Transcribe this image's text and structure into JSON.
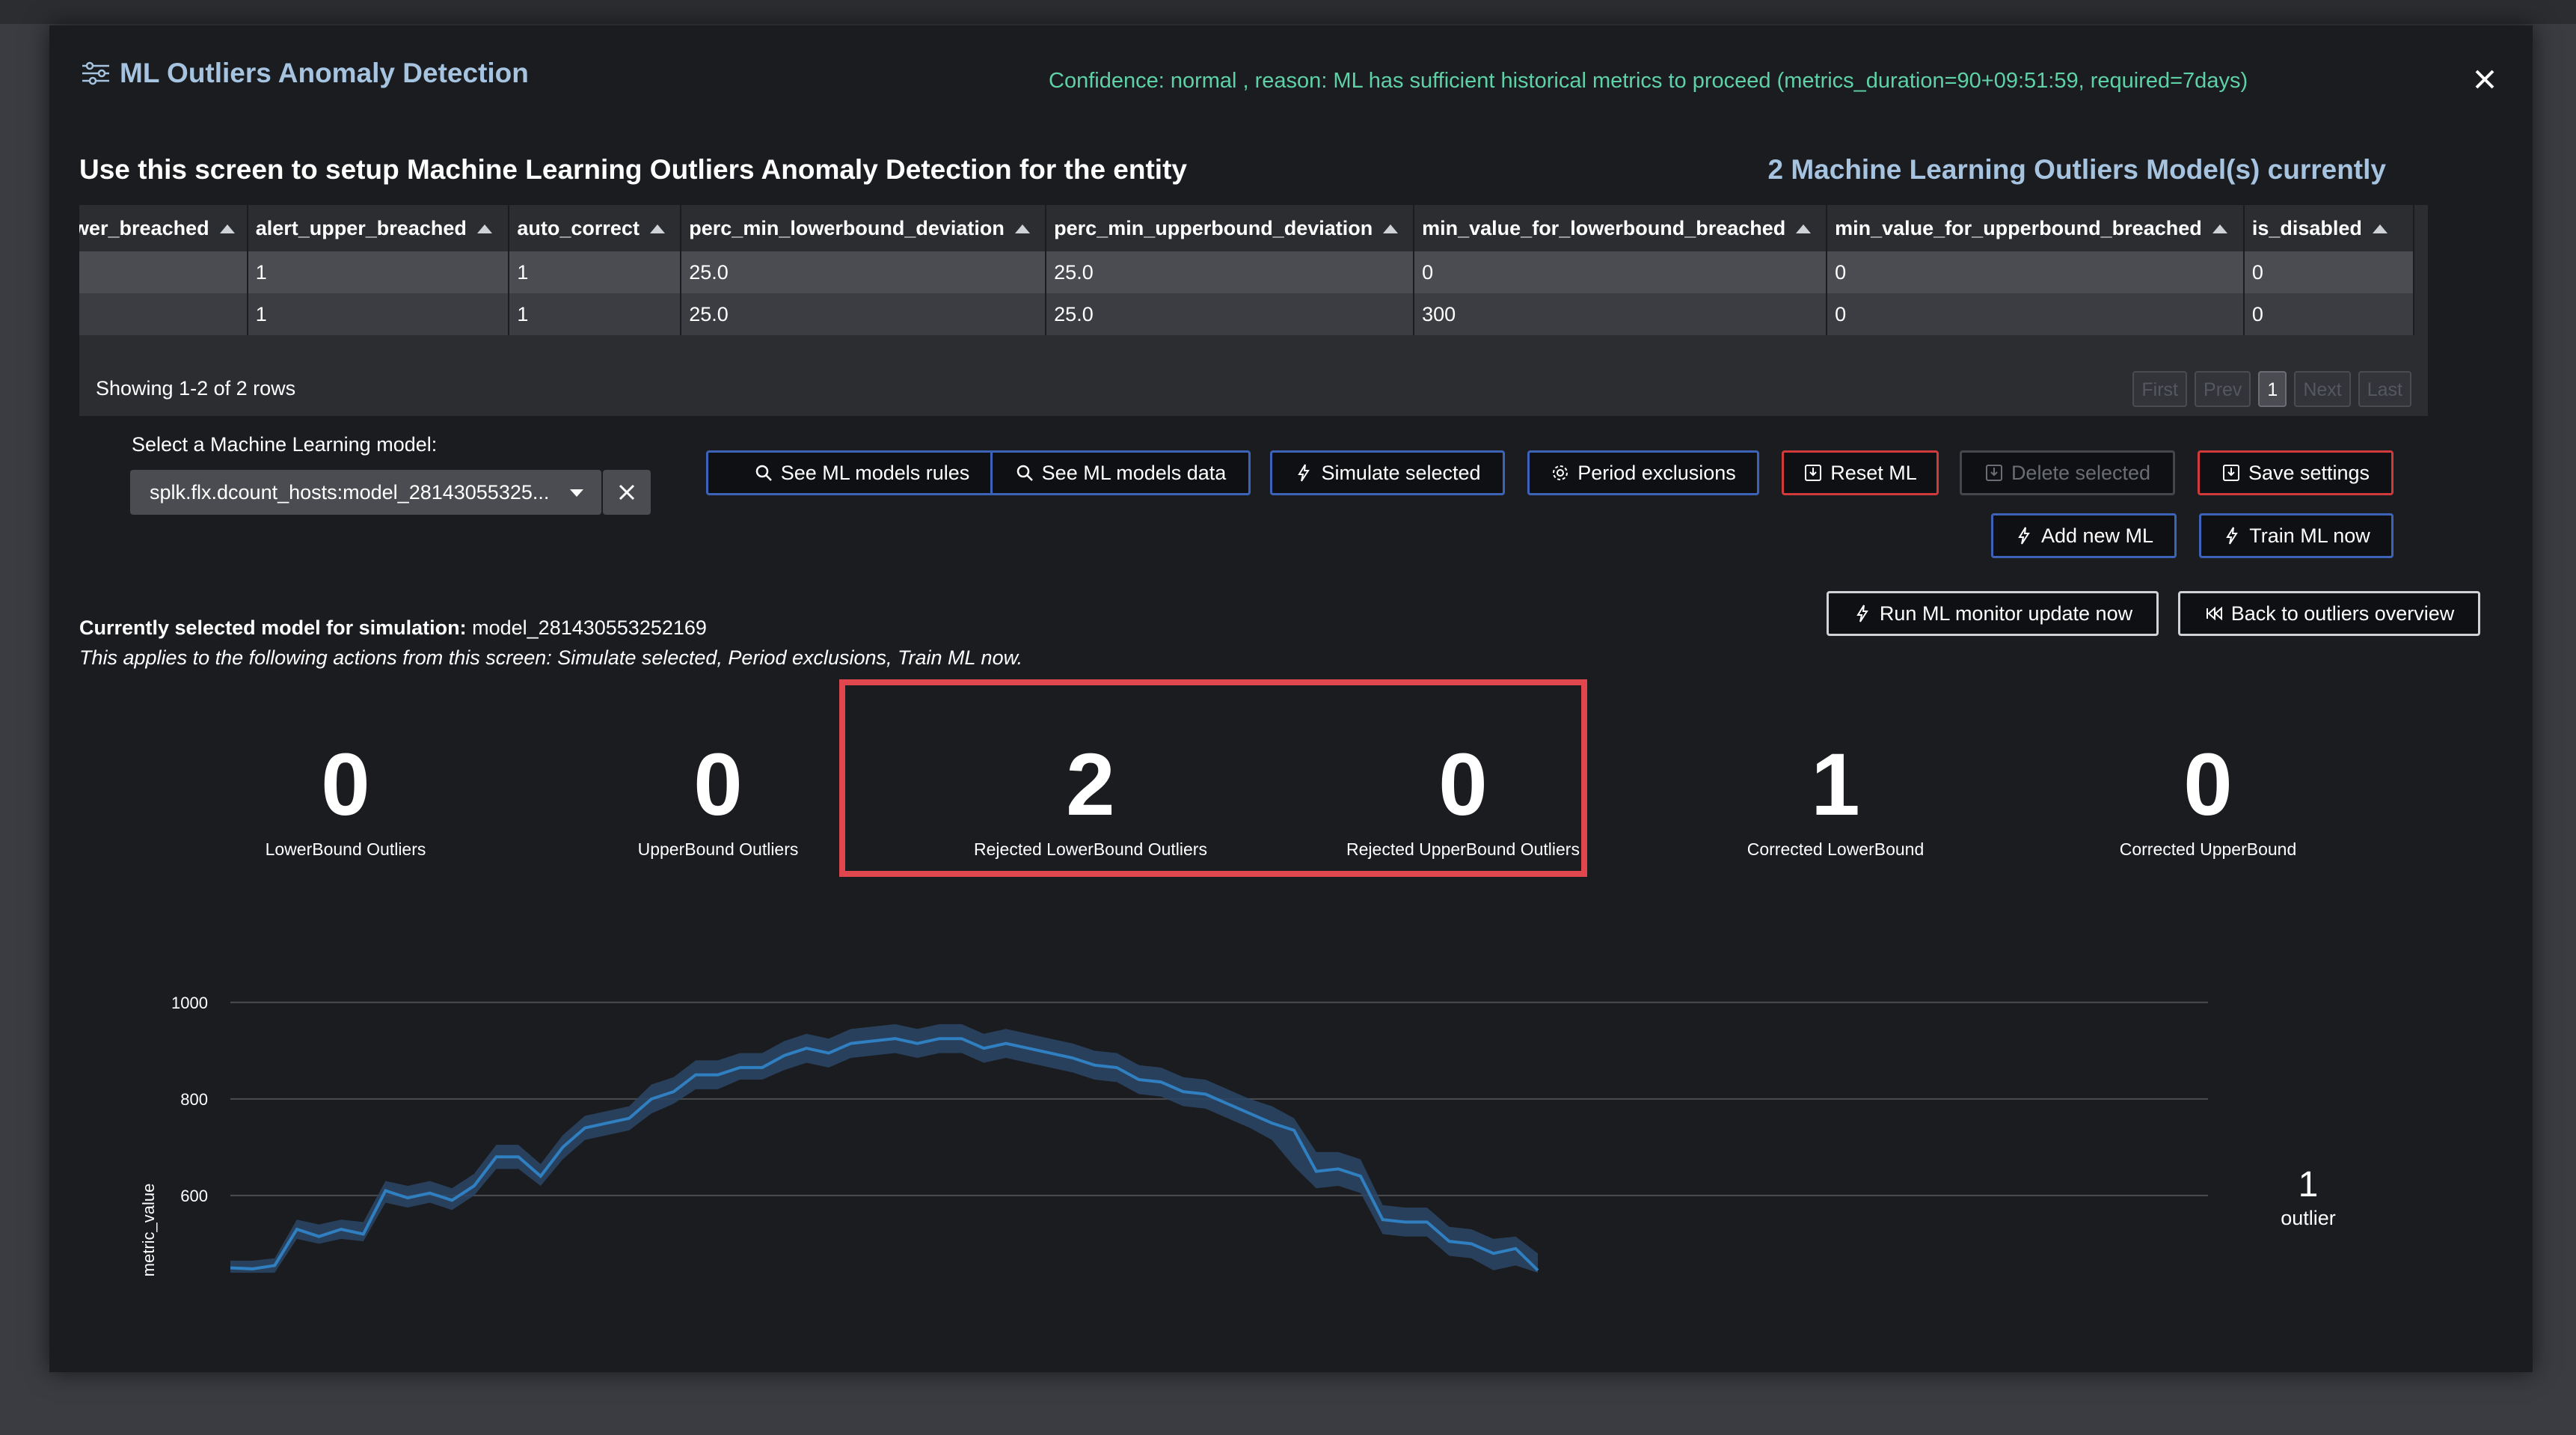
{
  "modal": {
    "title": "ML Outliers Anomaly Detection",
    "confidence": "Confidence: normal , reason: ML has sufficient historical metrics to proceed (metrics_duration=90+09:51:59, required=7days)",
    "heading": "Use this screen to setup Machine Learning Outliers Anomaly Detection for the entity",
    "models_count": "2 Machine Learning Outliers Model(s) currently"
  },
  "table": {
    "columns": [
      "wer_breached",
      "alert_upper_breached",
      "auto_correct",
      "perc_min_lowerbound_deviation",
      "perc_min_upperbound_deviation",
      "min_value_for_lowerbound_breached",
      "min_value_for_upperbound_breached",
      "is_disabled"
    ],
    "rows": [
      [
        "",
        "1",
        "1",
        "25.0",
        "25.0",
        "0",
        "0",
        "0"
      ],
      [
        "",
        "1",
        "1",
        "25.0",
        "25.0",
        "300",
        "0",
        "0"
      ]
    ],
    "showing": "Showing 1-2 of 2 rows",
    "pager": {
      "first": "First",
      "prev": "Prev",
      "page": "1",
      "next": "Next",
      "last": "Last"
    }
  },
  "model_select": {
    "label": "Select a Machine Learning model:",
    "value": "splk.flx.dcount_hosts:model_28143055325..."
  },
  "buttons": {
    "see_rules": "See ML models rules",
    "see_data": "See ML models data",
    "simulate": "Simulate selected",
    "period_exclusions": "Period exclusions",
    "reset_ml": "Reset ML",
    "delete_selected": "Delete selected",
    "save_settings": "Save settings",
    "add_new_ml": "Add new ML",
    "train_ml_now": "Train ML now",
    "run_monitor": "Run ML monitor update now",
    "back_overview": "Back to outliers overview"
  },
  "selection": {
    "label": "Currently selected model for simulation:",
    "model": "model_281430553252169",
    "applies": "This applies to the following actions from this screen: Simulate selected, Period exclusions, Train ML now."
  },
  "kpis": [
    {
      "value": "0",
      "label": "LowerBound Outliers"
    },
    {
      "value": "0",
      "label": "UpperBound Outliers"
    },
    {
      "value": "2",
      "label": "Rejected LowerBound Outliers"
    },
    {
      "value": "0",
      "label": "Rejected UpperBound Outliers"
    },
    {
      "value": "1",
      "label": "Corrected LowerBound"
    },
    {
      "value": "0",
      "label": "Corrected UpperBound"
    }
  ],
  "outliers": {
    "count": "1",
    "label": "outlier"
  },
  "colors": {
    "line": "#2f7fc1",
    "band": "#2b4766",
    "highlight": "#e0464b",
    "confidence": "#5fd1a6",
    "title": "#a6c3e0"
  },
  "chart_data": {
    "type": "line",
    "ylabel": "metric_value",
    "yticks": [
      600,
      800,
      1000
    ],
    "ylim": [
      420,
      1040
    ],
    "grid": true,
    "series": [
      {
        "values": [
          450,
          448,
          455,
          530,
          515,
          530,
          520,
          610,
          595,
          605,
          590,
          620,
          680,
          680,
          640,
          700,
          740,
          750,
          760,
          800,
          815,
          850,
          850,
          865,
          865,
          890,
          905,
          895,
          915,
          920,
          925,
          915,
          925,
          925,
          905,
          915,
          905,
          895,
          885,
          870,
          865,
          840,
          835,
          815,
          810,
          790,
          770,
          750,
          735,
          650,
          655,
          640,
          550,
          545,
          545,
          505,
          500,
          480,
          490,
          445
        ],
        "lower": [
          440,
          440,
          440,
          510,
          500,
          510,
          505,
          585,
          575,
          585,
          570,
          600,
          655,
          655,
          620,
          675,
          715,
          725,
          735,
          770,
          790,
          820,
          820,
          840,
          840,
          860,
          875,
          865,
          885,
          890,
          895,
          885,
          895,
          895,
          875,
          885,
          875,
          865,
          855,
          840,
          835,
          810,
          805,
          785,
          780,
          760,
          740,
          715,
          660,
          615,
          620,
          605,
          520,
          515,
          515,
          475,
          470,
          445,
          455,
          440
        ],
        "upper": [
          465,
          465,
          470,
          550,
          540,
          550,
          545,
          630,
          620,
          630,
          615,
          645,
          705,
          705,
          665,
          725,
          765,
          775,
          785,
          830,
          845,
          880,
          880,
          895,
          895,
          920,
          935,
          925,
          945,
          950,
          955,
          945,
          955,
          955,
          935,
          945,
          935,
          925,
          915,
          900,
          895,
          870,
          865,
          845,
          840,
          820,
          800,
          785,
          760,
          690,
          690,
          675,
          580,
          575,
          575,
          535,
          530,
          510,
          515,
          480
        ]
      }
    ]
  }
}
